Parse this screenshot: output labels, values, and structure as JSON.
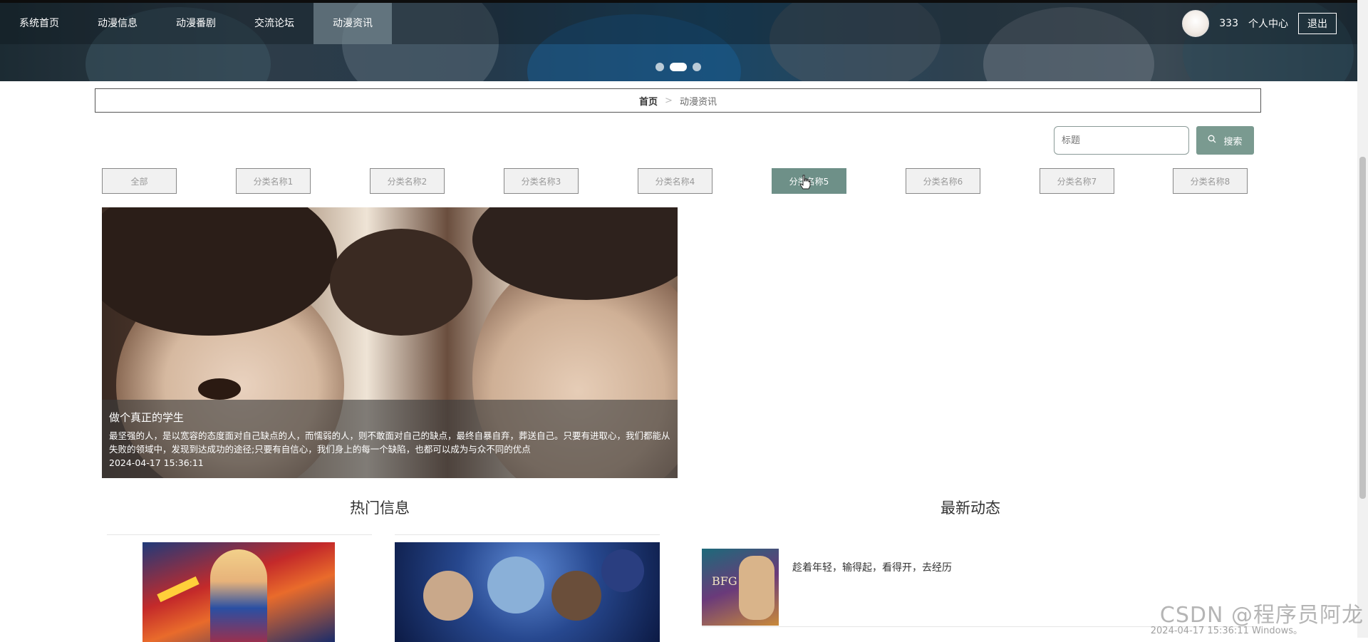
{
  "nav": {
    "items": [
      {
        "label": "系统首页"
      },
      {
        "label": "动漫信息"
      },
      {
        "label": "动漫番剧"
      },
      {
        "label": "交流论坛"
      },
      {
        "label": "动漫资讯"
      }
    ],
    "active_index": 4,
    "username": "333",
    "user_center": "个人中心",
    "logout": "退出"
  },
  "carousel": {
    "dots": 3,
    "active": 1
  },
  "breadcrumb": {
    "home": "首页",
    "separator": ">",
    "current": "动漫资讯"
  },
  "search": {
    "placeholder": "标题",
    "button": "搜索"
  },
  "categories": {
    "items": [
      "全部",
      "分类名称1",
      "分类名称2",
      "分类名称3",
      "分类名称4",
      "分类名称5",
      "分类名称6",
      "分类名称7",
      "分类名称8"
    ],
    "active_index": 5
  },
  "featured": {
    "title": "做个真正的学生",
    "description": "最坚强的人，是以宽容的态度面对自己缺点的人，而懦弱的人，则不敢面对自己的缺点，最终自暴自弃，葬送自己。只要有进取心，我们都能从失败的领域中，发现到达成功的途径;只要有自信心，我们身上的每一个缺陷，也都可以成为与众不同的优点",
    "time": "2024-04-17 15:36:11"
  },
  "sections": {
    "hot": "热门信息",
    "latest": "最新动态"
  },
  "latest": [
    {
      "title": "趁着年轻，输得起，看得开，去经历",
      "thumb_text": "BFG"
    }
  ],
  "watermark": {
    "text": "CSDN @程序员阿龙",
    "system": "2024-04-17 15:36:11 Windows。"
  },
  "colors": {
    "accent": "#6e9088",
    "search_button": "#7a9a90"
  }
}
